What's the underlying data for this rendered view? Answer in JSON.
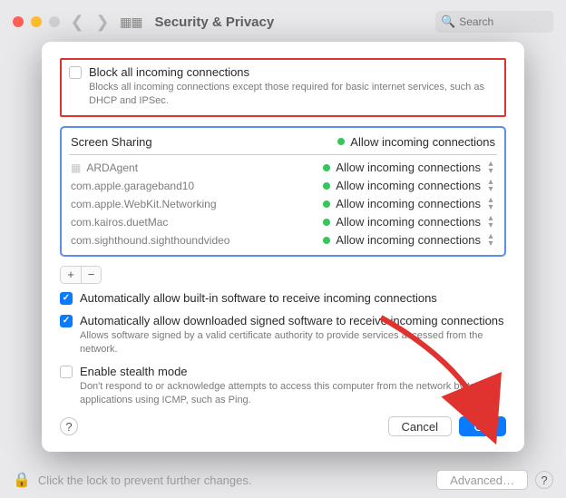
{
  "toolbar": {
    "title": "Security & Privacy",
    "search_placeholder": "Search"
  },
  "block_all": {
    "label": "Block all incoming connections",
    "desc": "Blocks all incoming connections except those required for basic internet services, such as DHCP and IPSec."
  },
  "apps": {
    "header_name": "Screen Sharing",
    "header_status": "Allow incoming connections",
    "rows": [
      {
        "name": "ARDAgent",
        "status": "Allow incoming connections"
      },
      {
        "name": "com.apple.garageband10",
        "status": "Allow incoming connections"
      },
      {
        "name": "com.apple.WebKit.Networking",
        "status": "Allow incoming connections"
      },
      {
        "name": "com.kairos.duetMac",
        "status": "Allow incoming connections"
      },
      {
        "name": "com.sighthound.sighthoundvideo",
        "status": "Allow incoming connections"
      }
    ]
  },
  "add_label": "+",
  "remove_label": "−",
  "auto_builtin": {
    "label": "Automatically allow built-in software to receive incoming connections"
  },
  "auto_signed": {
    "label": "Automatically allow downloaded signed software to receive incoming connections",
    "desc": "Allows software signed by a valid certificate authority to provide services accessed from the network."
  },
  "stealth": {
    "label": "Enable stealth mode",
    "desc": "Don't respond to or acknowledge attempts to access this computer from the network by test applications using ICMP, such as Ping."
  },
  "help_label": "?",
  "cancel_label": "Cancel",
  "ok_label": "OK",
  "bottom": {
    "lock_text": "Click the lock to prevent further changes.",
    "advanced_label": "Advanced…",
    "help_label": "?"
  }
}
